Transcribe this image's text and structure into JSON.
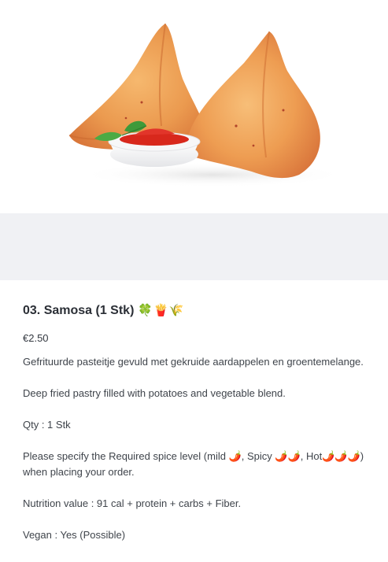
{
  "product": {
    "image_alt": "samosa-photo",
    "title": "03. Samosa (1 Stk)",
    "title_emojis": [
      "🍀",
      "🍟",
      "🌾"
    ],
    "price": "€2.50",
    "description_nl": "Gefrituurde pasteitje gevuld met gekruide aardappelen en groentemelange.",
    "description_en": "Deep fried pastry filled with potatoes and vegetable blend.",
    "qty": "Qty : 1 Stk",
    "spice_note_prefix": "Please specify the Required spice level (mild ",
    "spice_mild": "🌶️",
    "spice_spicy_label": ", Spicy ",
    "spice_spicy": "🌶️🌶️",
    "spice_hot_label": ", Hot",
    "spice_hot": "🌶️🌶️🌶️",
    "spice_note_suffix": ") when placing your order.",
    "nutrition": "Nutrition value : 91 cal + protein + carbs + Fiber.",
    "vegan": "Vegan : Yes (Possible)"
  },
  "colors": {
    "background": "#ffffff",
    "band": "#f0f1f4",
    "text": "#333840",
    "pastry": "#e9924a",
    "sauce": "#d8281c"
  }
}
